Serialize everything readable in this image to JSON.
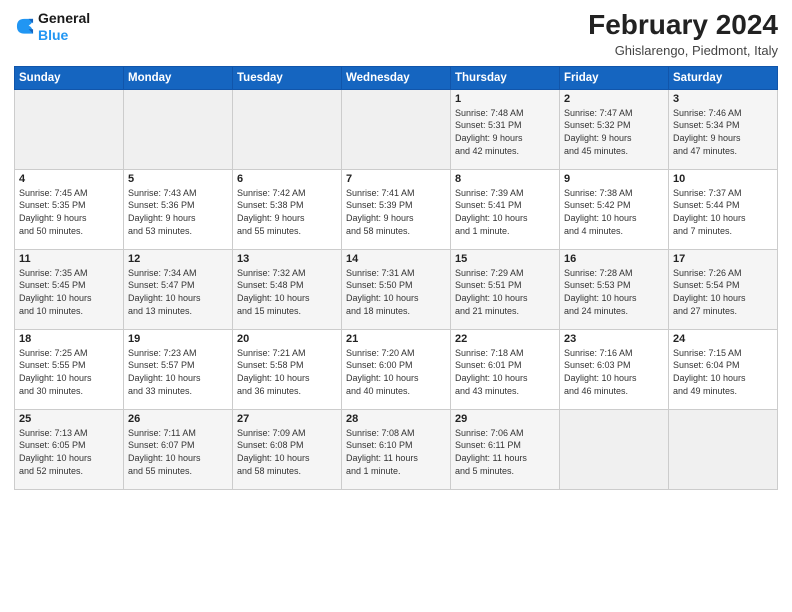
{
  "logo": {
    "line1": "General",
    "line2": "Blue"
  },
  "title": "February 2024",
  "subtitle": "Ghislarengo, Piedmont, Italy",
  "headers": [
    "Sunday",
    "Monday",
    "Tuesday",
    "Wednesday",
    "Thursday",
    "Friday",
    "Saturday"
  ],
  "weeks": [
    [
      {
        "day": "",
        "info": ""
      },
      {
        "day": "",
        "info": ""
      },
      {
        "day": "",
        "info": ""
      },
      {
        "day": "",
        "info": ""
      },
      {
        "day": "1",
        "info": "Sunrise: 7:48 AM\nSunset: 5:31 PM\nDaylight: 9 hours\nand 42 minutes."
      },
      {
        "day": "2",
        "info": "Sunrise: 7:47 AM\nSunset: 5:32 PM\nDaylight: 9 hours\nand 45 minutes."
      },
      {
        "day": "3",
        "info": "Sunrise: 7:46 AM\nSunset: 5:34 PM\nDaylight: 9 hours\nand 47 minutes."
      }
    ],
    [
      {
        "day": "4",
        "info": "Sunrise: 7:45 AM\nSunset: 5:35 PM\nDaylight: 9 hours\nand 50 minutes."
      },
      {
        "day": "5",
        "info": "Sunrise: 7:43 AM\nSunset: 5:36 PM\nDaylight: 9 hours\nand 53 minutes."
      },
      {
        "day": "6",
        "info": "Sunrise: 7:42 AM\nSunset: 5:38 PM\nDaylight: 9 hours\nand 55 minutes."
      },
      {
        "day": "7",
        "info": "Sunrise: 7:41 AM\nSunset: 5:39 PM\nDaylight: 9 hours\nand 58 minutes."
      },
      {
        "day": "8",
        "info": "Sunrise: 7:39 AM\nSunset: 5:41 PM\nDaylight: 10 hours\nand 1 minute."
      },
      {
        "day": "9",
        "info": "Sunrise: 7:38 AM\nSunset: 5:42 PM\nDaylight: 10 hours\nand 4 minutes."
      },
      {
        "day": "10",
        "info": "Sunrise: 7:37 AM\nSunset: 5:44 PM\nDaylight: 10 hours\nand 7 minutes."
      }
    ],
    [
      {
        "day": "11",
        "info": "Sunrise: 7:35 AM\nSunset: 5:45 PM\nDaylight: 10 hours\nand 10 minutes."
      },
      {
        "day": "12",
        "info": "Sunrise: 7:34 AM\nSunset: 5:47 PM\nDaylight: 10 hours\nand 13 minutes."
      },
      {
        "day": "13",
        "info": "Sunrise: 7:32 AM\nSunset: 5:48 PM\nDaylight: 10 hours\nand 15 minutes."
      },
      {
        "day": "14",
        "info": "Sunrise: 7:31 AM\nSunset: 5:50 PM\nDaylight: 10 hours\nand 18 minutes."
      },
      {
        "day": "15",
        "info": "Sunrise: 7:29 AM\nSunset: 5:51 PM\nDaylight: 10 hours\nand 21 minutes."
      },
      {
        "day": "16",
        "info": "Sunrise: 7:28 AM\nSunset: 5:53 PM\nDaylight: 10 hours\nand 24 minutes."
      },
      {
        "day": "17",
        "info": "Sunrise: 7:26 AM\nSunset: 5:54 PM\nDaylight: 10 hours\nand 27 minutes."
      }
    ],
    [
      {
        "day": "18",
        "info": "Sunrise: 7:25 AM\nSunset: 5:55 PM\nDaylight: 10 hours\nand 30 minutes."
      },
      {
        "day": "19",
        "info": "Sunrise: 7:23 AM\nSunset: 5:57 PM\nDaylight: 10 hours\nand 33 minutes."
      },
      {
        "day": "20",
        "info": "Sunrise: 7:21 AM\nSunset: 5:58 PM\nDaylight: 10 hours\nand 36 minutes."
      },
      {
        "day": "21",
        "info": "Sunrise: 7:20 AM\nSunset: 6:00 PM\nDaylight: 10 hours\nand 40 minutes."
      },
      {
        "day": "22",
        "info": "Sunrise: 7:18 AM\nSunset: 6:01 PM\nDaylight: 10 hours\nand 43 minutes."
      },
      {
        "day": "23",
        "info": "Sunrise: 7:16 AM\nSunset: 6:03 PM\nDaylight: 10 hours\nand 46 minutes."
      },
      {
        "day": "24",
        "info": "Sunrise: 7:15 AM\nSunset: 6:04 PM\nDaylight: 10 hours\nand 49 minutes."
      }
    ],
    [
      {
        "day": "25",
        "info": "Sunrise: 7:13 AM\nSunset: 6:05 PM\nDaylight: 10 hours\nand 52 minutes."
      },
      {
        "day": "26",
        "info": "Sunrise: 7:11 AM\nSunset: 6:07 PM\nDaylight: 10 hours\nand 55 minutes."
      },
      {
        "day": "27",
        "info": "Sunrise: 7:09 AM\nSunset: 6:08 PM\nDaylight: 10 hours\nand 58 minutes."
      },
      {
        "day": "28",
        "info": "Sunrise: 7:08 AM\nSunset: 6:10 PM\nDaylight: 11 hours\nand 1 minute."
      },
      {
        "day": "29",
        "info": "Sunrise: 7:06 AM\nSunset: 6:11 PM\nDaylight: 11 hours\nand 5 minutes."
      },
      {
        "day": "",
        "info": ""
      },
      {
        "day": "",
        "info": ""
      }
    ]
  ]
}
